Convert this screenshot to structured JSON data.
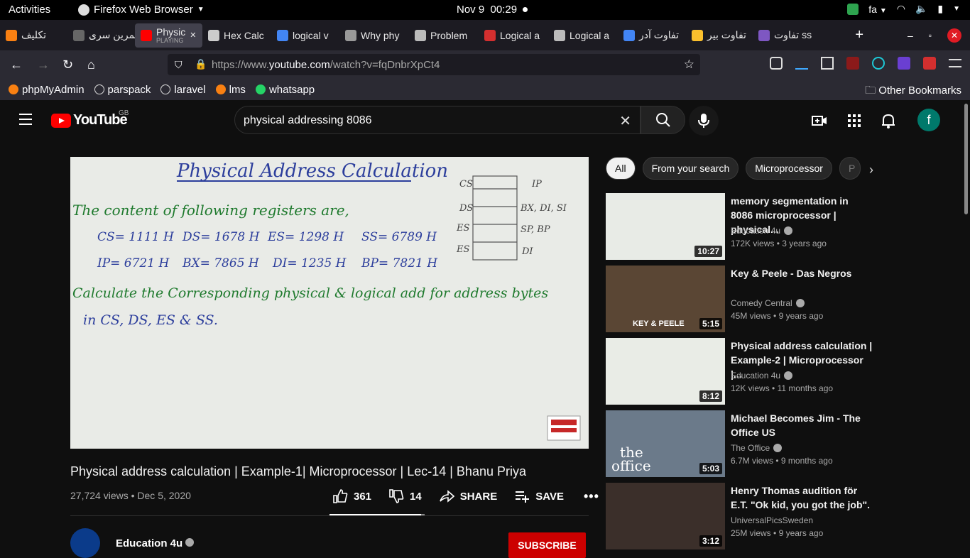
{
  "gnome": {
    "activities": "Activities",
    "app_name": "Firefox Web Browser",
    "date": "Nov 9",
    "time": "00:29",
    "lang": "fa"
  },
  "tabs": [
    {
      "label": "تکلیف",
      "icon": "moodle-icon",
      "color": "#f98012"
    },
    {
      "label": "تمرین سری",
      "icon": "doc-icon",
      "color": "#666"
    },
    {
      "label": "Physic",
      "sub": "PLAYING",
      "icon": "youtube-icon",
      "color": "#f00",
      "active": true
    },
    {
      "label": "Hex Calc",
      "icon": "calculator-icon",
      "color": "#ccc"
    },
    {
      "label": "logical v",
      "icon": "google-icon",
      "color": "#4285f4"
    },
    {
      "label": "Why phy",
      "icon": "stackexchange-icon",
      "color": "#999"
    },
    {
      "label": "Problem",
      "icon": "info-icon",
      "color": "#bbb"
    },
    {
      "label": "Logical a",
      "icon": "c-icon",
      "color": "#d32f2f"
    },
    {
      "label": "Logical a",
      "icon": "exchange-icon",
      "color": "#bbb"
    },
    {
      "label": "تفاوت آدر",
      "icon": "google-icon",
      "color": "#4285f4"
    },
    {
      "label": "تفاوت بیر",
      "icon": "bulb-icon",
      "color": "#fbc02d"
    },
    {
      "label": "تفاوت ss",
      "icon": "puzzle-icon",
      "color": "#7e57c2"
    }
  ],
  "url": {
    "prefix": "https://www.",
    "domain": "youtube.com",
    "path": "/watch?v=fqDnbrXpCt4"
  },
  "bookmarks": [
    {
      "label": "phpMyAdmin",
      "icon": "phpmyadmin-icon"
    },
    {
      "label": "parspack",
      "icon": "globe-icon"
    },
    {
      "label": "laravel",
      "icon": "globe-icon"
    },
    {
      "label": "lms",
      "icon": "moodle-icon"
    },
    {
      "label": "whatsapp",
      "icon": "whatsapp-icon"
    }
  ],
  "other_bookmarks": "Other Bookmarks",
  "youtube": {
    "logo_text": "YouTube",
    "region": "GB",
    "search_value": "physical addressing 8086",
    "avatar_letter": "f"
  },
  "board": {
    "heading": "Physical Address Calculation",
    "line1": "The content of following registers are,",
    "cs": "CS= 1111 H",
    "ds": "DS= 1678 H",
    "es": "ES= 1298 H",
    "ss": "SS= 6789 H",
    "ip": "IP= 6721 H",
    "bx": "BX= 7865 H",
    "di": "DI= 1235 H",
    "bp": "BP= 7821 H",
    "line3": "Calculate the Corresponding physical & logical add for address bytes",
    "line4": "in CS, DS, ES & SS.",
    "seg_labels": [
      "CS",
      "DS",
      "ES",
      "ES"
    ],
    "seg_regs": [
      "IP",
      "BX, DI, SI",
      "SP, BP",
      "DI"
    ]
  },
  "video": {
    "title": "Physical address calculation | Example-1| Microprocessor | Lec-14 | Bhanu Priya",
    "views": "27,724 views",
    "date": "Dec 5, 2020",
    "likes": "361",
    "dislikes": "14",
    "share": "SHARE",
    "save": "SAVE",
    "like_ratio": 0.963,
    "channel": "Education 4u",
    "subscribe": "SUBSCRIBE"
  },
  "chips": [
    "All",
    "From your search",
    "Microprocessor",
    "P"
  ],
  "recommendations": [
    {
      "title": "memory segmentation in 8086 microprocessor | physical...",
      "channel": "Education 4u",
      "views": "172K views",
      "age": "3 years ago",
      "duration": "10:27"
    },
    {
      "title": "Key & Peele - Das Negros",
      "channel": "Comedy Central",
      "views": "45M views",
      "age": "9 years ago",
      "duration": "5:15",
      "overlay": "KEY & PEELE"
    },
    {
      "title": "Physical address calculation | Example-2 | Microprocessor |...",
      "channel": "Education 4u",
      "views": "12K views",
      "age": "11 months ago",
      "duration": "8:12"
    },
    {
      "title": "Michael Becomes Jim - The Office US",
      "channel": "The Office",
      "views": "6.7M views",
      "age": "9 months ago",
      "duration": "5:03",
      "overlay1": "the",
      "overlay2": "office"
    },
    {
      "title": "Henry Thomas audition för E.T. \"Ok kid, you got the job\".",
      "channel": "UniversalPicsSweden",
      "views": "25M views",
      "age": "9 years ago",
      "duration": "3:12"
    }
  ]
}
